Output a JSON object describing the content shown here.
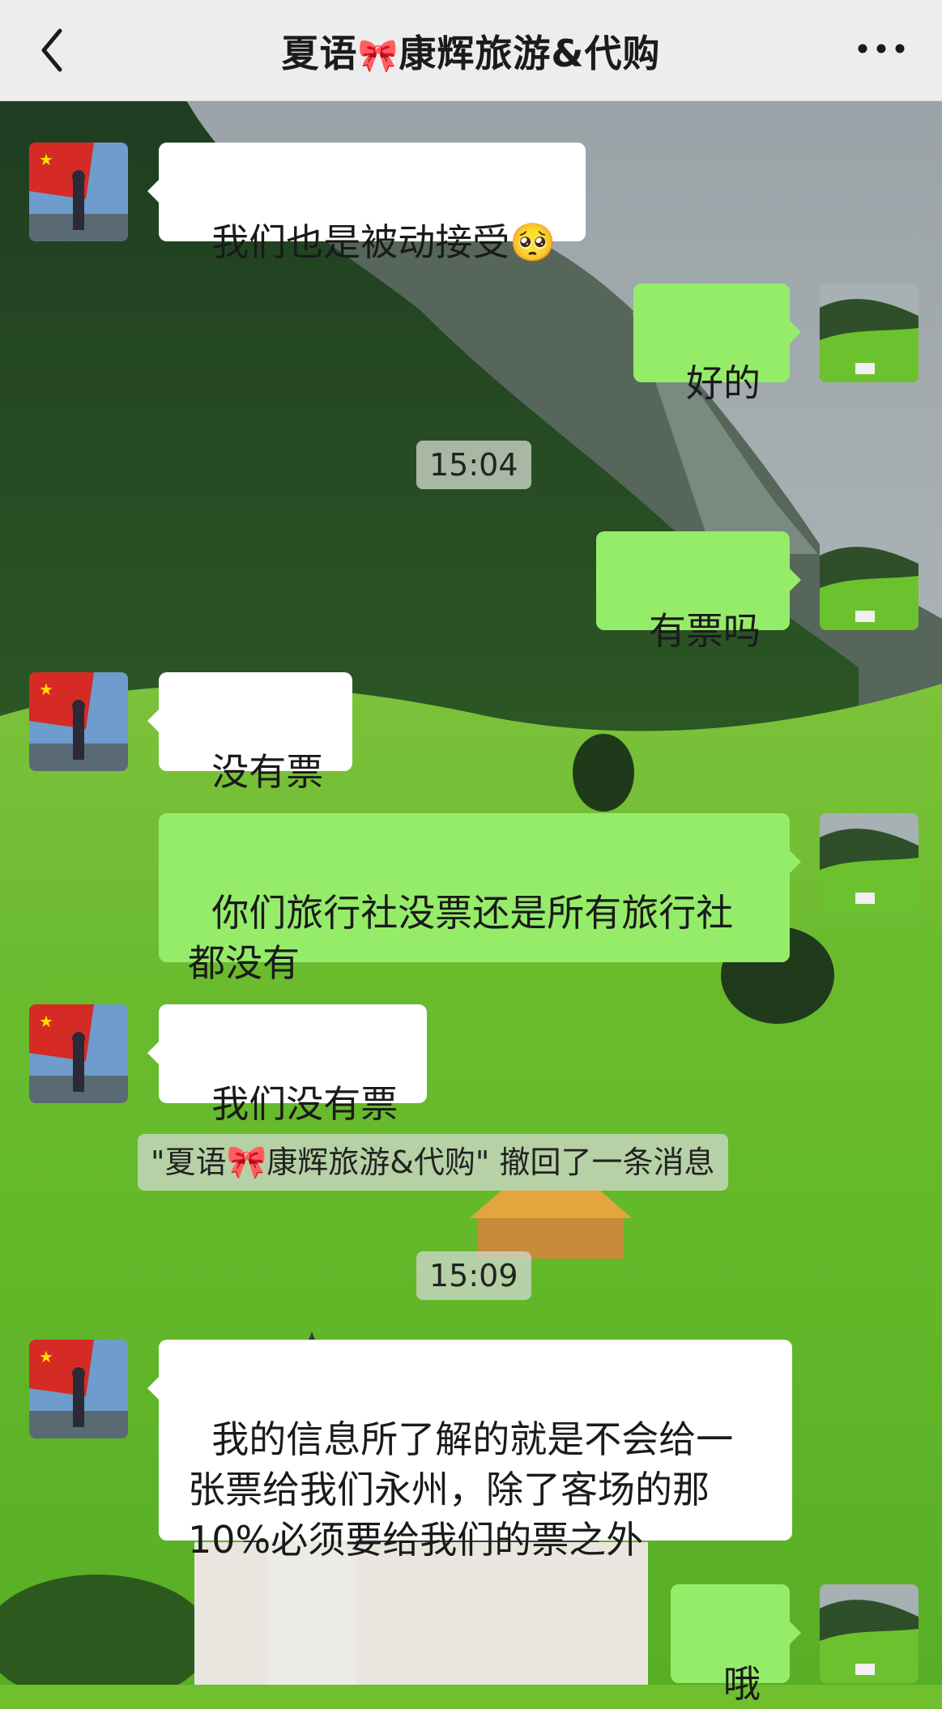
{
  "header": {
    "back_icon": "chevron-left-icon",
    "title_part1": "夏语",
    "title_emoji": "🎀",
    "title_part2": "康辉旅游&代购",
    "more_icon": "more-dots-icon"
  },
  "messages": [
    {
      "id": "m1",
      "side": "in",
      "text": "我们也是被动接受",
      "emoji": "🥺"
    },
    {
      "id": "m2",
      "side": "out",
      "text": "好的"
    },
    {
      "id": "t1",
      "type": "time",
      "text": "15:04"
    },
    {
      "id": "m3",
      "side": "out",
      "text": "有票吗"
    },
    {
      "id": "m4",
      "side": "in",
      "text": "没有票"
    },
    {
      "id": "m5",
      "side": "out",
      "text": "你们旅行社没票还是所有旅行社\n都没有"
    },
    {
      "id": "m6",
      "side": "in",
      "text": "我们没有票"
    },
    {
      "id": "s1",
      "type": "system",
      "text_part1": "\"夏语",
      "text_emoji": "🎀",
      "text_part2": "康辉旅游&代购\" 撤回了一条消息"
    },
    {
      "id": "t2",
      "type": "time",
      "text": "15:09"
    },
    {
      "id": "m7",
      "side": "in",
      "text": "我的信息所了解的就是不会给一\n张票给我们永州，除了客场的那\n10%必须要给我们的票之外"
    },
    {
      "id": "m8",
      "side": "out",
      "text": "哦"
    }
  ],
  "colors": {
    "header_bg": "#ededed",
    "bubble_out": "#95ec69",
    "bubble_in": "#ffffff"
  }
}
